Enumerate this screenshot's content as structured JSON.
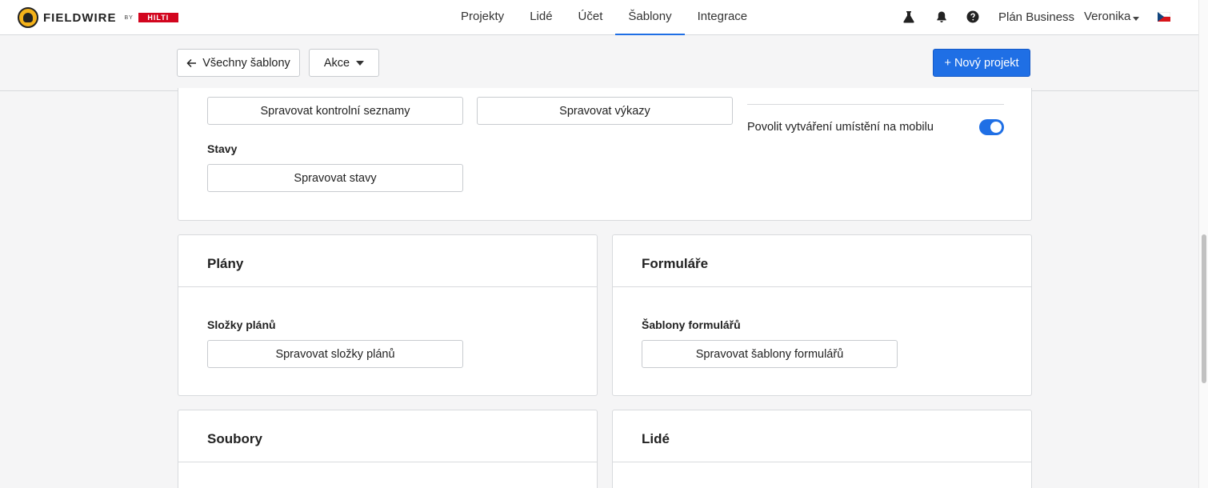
{
  "brand": {
    "name": "FIELDWIRE",
    "by": "BY",
    "partner": "HILTI"
  },
  "nav": {
    "links": [
      {
        "label": "Projekty",
        "active": false
      },
      {
        "label": "Lidé",
        "active": false
      },
      {
        "label": "Účet",
        "active": false
      },
      {
        "label": "Šablony",
        "active": true
      },
      {
        "label": "Integrace",
        "active": false
      }
    ],
    "plan": "Plán Business",
    "user": "Veronika",
    "icons": [
      "flask-icon",
      "bell-icon",
      "help-icon",
      "flag-cz-icon"
    ]
  },
  "toolbar": {
    "back_label": "Všechny šablony",
    "actions_label": "Akce",
    "new_project_label": "+ Nový projekt"
  },
  "top_section": {
    "checklists_button": "Spravovat kontrolní seznamy",
    "reports_button": "Spravovat výkazy",
    "states_label": "Stavy",
    "states_button": "Spravovat stavy",
    "toggle_label": "Povolit vytváření umístění na mobilu",
    "toggle_on": true
  },
  "plany": {
    "title": "Plány",
    "folders_label": "Složky plánů",
    "folders_button": "Spravovat složky plánů"
  },
  "formulare": {
    "title": "Formuláře",
    "templates_label": "Šablony formulářů",
    "templates_button": "Spravovat šablony formulářů"
  },
  "soubory": {
    "title": "Soubory"
  },
  "lide": {
    "title": "Lidé"
  },
  "colors": {
    "primary": "#1f6fe5",
    "hilti_red": "#d2051e",
    "logo_yellow": "#f4b21a"
  }
}
